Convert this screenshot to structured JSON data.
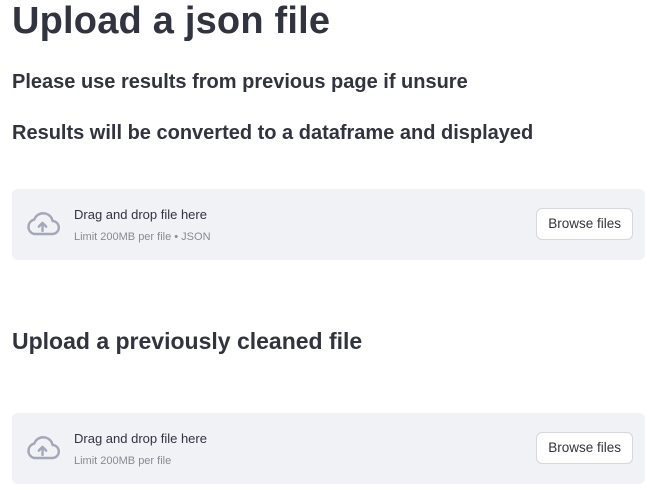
{
  "header": {
    "title": "Upload a json file",
    "line1": "Please use results from previous page if unsure",
    "line2": "Results will be converted to a dataframe and displayed"
  },
  "uploader_json": {
    "icon": "cloud-upload-icon",
    "drag_text": "Drag and drop file here",
    "limit_text": "Limit 200MB per file • JSON",
    "button_label": "Browse files"
  },
  "cleaned_section": {
    "title": "Upload a previously cleaned file"
  },
  "uploader_cleaned": {
    "icon": "cloud-upload-icon",
    "drag_text": "Drag and drop file here",
    "limit_text": "Limit 200MB per file",
    "button_label": "Browse files"
  },
  "colors": {
    "text": "#31333f",
    "muted": "#888a93",
    "dropzone_bg": "#f0f2f6",
    "icon": "#a3a8b8"
  }
}
